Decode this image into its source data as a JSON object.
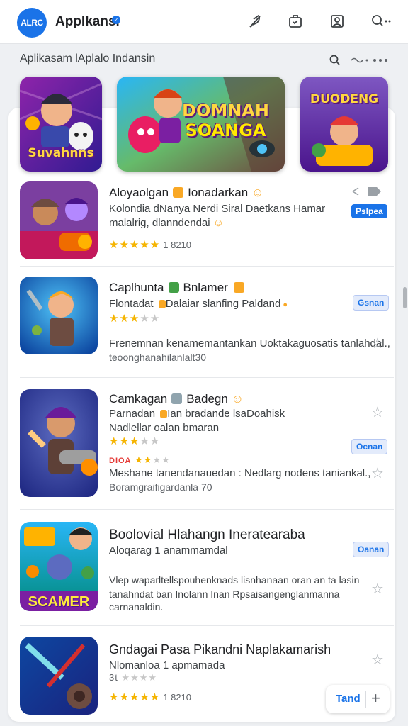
{
  "header": {
    "logo_text": "ALRC",
    "title": "Applkansi",
    "icons": [
      "feather-icon",
      "briefcase-icon",
      "image-frame-icon",
      "search-more-icon"
    ]
  },
  "subheader": {
    "title": "Aplikasam lAplalo Indansin",
    "icons": [
      "search-icon",
      "voice-icon",
      "more-dots-icon"
    ]
  },
  "banners": [
    {
      "text": "Suvahnns"
    },
    {
      "text_line1": "DOMNAH",
      "text_line2": "SOANGA"
    },
    {
      "text": "DUODENG"
    }
  ],
  "apps": [
    {
      "title": "Aloyaolgan",
      "title_suffix": "Ionadarkan",
      "line1": "Kolondia dNanya Nerdi Siral Daetkans Hamar",
      "line2": "malalrig, dlanndendai",
      "stars_full": 5,
      "stars_empty": 0,
      "rating": "1 8210",
      "pill": "Pslpea",
      "pill_style": "blue"
    },
    {
      "title": "Caplhunta",
      "title_suffix": "Bnlamer",
      "line1": "Flontadat",
      "line1_rest": "Dalaiar slanfing Paldand",
      "stars_full": 3,
      "stars_empty": 2,
      "pill": "Gsnan",
      "pill_style": "light",
      "desc1": "Frenemnan kenamemantankan Uoktakaguosatis tanlahdal.,",
      "desc2": "teoonghanahilanlalt30"
    },
    {
      "title": "Camkagan",
      "title_suffix": "Badegn",
      "line1": "Parnadan",
      "line1_rest": "Ian bradande lsaDoahisk",
      "line2": "Nadlellar oalan bmaran",
      "stars_full": 3,
      "stars_empty": 2,
      "pill": "Ocnan",
      "pill_style": "light",
      "mini_label": "DIOA",
      "desc1": "Meshane tanendanauedan : Nedlarg nodens taniankal.,",
      "desc2": "Boramgraifigardanla 70"
    },
    {
      "title": "Boolovial Hlahangn Ineratearaba",
      "line1": "Aloqarag 1 anammamdal",
      "pill": "Oanan",
      "pill_style": "light",
      "desc1": "Vlep waparltellspouhenknads lisnhanaan oran an ta lasin",
      "desc2": "tanahndat ban Inolann Inan Rpsaisangenglanmanna",
      "desc3": "carnanaldin."
    },
    {
      "title": "Gndagai Pasa Pikandni Naplakamarish",
      "line1": "Nlomanloa 1 apmamada",
      "line2": "3t",
      "stars_full": 5,
      "stars_empty": 0,
      "rating": "1 8210"
    }
  ],
  "fab": {
    "label": "Tand",
    "plus": "+"
  },
  "colors": {
    "accent": "#1a73e8",
    "star": "#f5b400",
    "background": "#eef0f3"
  }
}
